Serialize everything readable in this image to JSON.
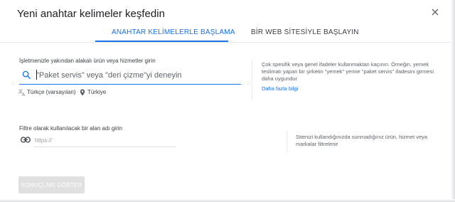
{
  "dialog": {
    "title": "Yeni anahtar kelimeler keşfedin",
    "close_icon": "close-icon"
  },
  "tabs": [
    {
      "label": "ANAHTAR KELİMELERLE BAŞLAMA",
      "active": true
    },
    {
      "label": "BİR WEB SİTESİYLE BAŞLAYIN",
      "active": false
    }
  ],
  "keywords_section": {
    "label": "İşletmenizle yakından alakalı ürün veya hizmetler girin",
    "search_icon": "search-icon",
    "placeholder": "\"Paket servis\" veya \"deri çizme\"yi deneyin",
    "value": "",
    "language_icon": "translate-icon",
    "language": "Türkçe (varsayılan)",
    "location_icon": "location-pin-icon",
    "location": "Türkiye",
    "help_text": "Çok spesifik veya genel ifadeler kullanmaktan kaçının. Örneğin, yemek teslimatı yapan bir şirketin \"yemek\" yerine \"paket servis\" ifadesini girmesi daha uygundur",
    "help_link": "Daha fazla bilgi"
  },
  "filter_section": {
    "label": "Filtre olarak kullanılacak bir alan adı girin",
    "link_icon": "link-icon",
    "placeholder": "https://",
    "value": "",
    "help_text": "Sitenizi kullandığınızda sunmadığınız ürün, hizmet veya markalar filtrelenir"
  },
  "actions": {
    "show_results_label": "SONUÇLARI GÖSTER",
    "show_results_enabled": false
  },
  "colors": {
    "accent": "#1a73e8",
    "text_primary": "#202124",
    "text_secondary": "#5f6368",
    "disabled_button": "#e0e0e0"
  }
}
